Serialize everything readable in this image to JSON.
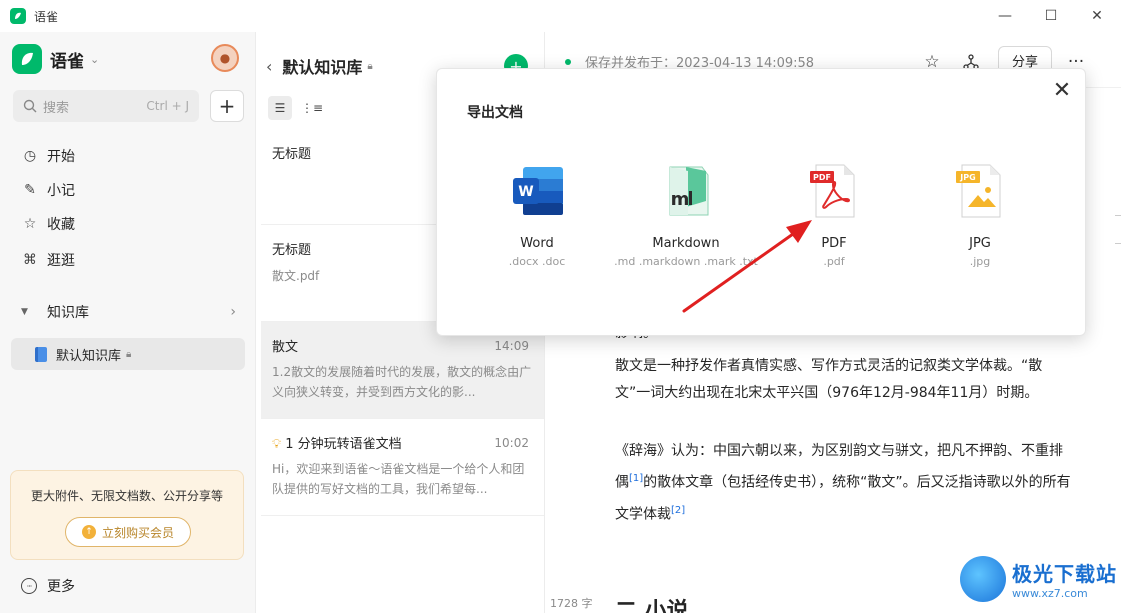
{
  "window": {
    "title": "语雀",
    "minimize": "—",
    "maximize": "☐",
    "close": "✕"
  },
  "sidebar": {
    "brand": "语雀",
    "search_placeholder": "搜索",
    "search_shortcut": "Ctrl + J",
    "add_label": "+",
    "nav": [
      {
        "label": "开始"
      },
      {
        "label": "小记"
      },
      {
        "label": "收藏"
      },
      {
        "label": "逛逛"
      }
    ],
    "knowledge_base_header": "知识库",
    "knowledge_base_item": "默认知识库",
    "promo_text": "更大附件、无限文档数、公开分享等",
    "promo_button": "立刻购买会员",
    "more": "更多"
  },
  "doclist": {
    "title": "默认知识库",
    "items": [
      {
        "title": "无标题",
        "time": "",
        "summary": ""
      },
      {
        "title": "无标题",
        "time": "",
        "summary": "散文.pdf"
      },
      {
        "title": "散文",
        "time": "14:09",
        "summary": "1.2散文的发展随着时代的发展，散文的概念由广义向狭义转变，并受到西方文化的影..."
      },
      {
        "title": "1 分钟玩转语雀文档",
        "time": "10:02",
        "summary": "Hi，欢迎来到语雀～语雀文档是一个给个人和团队提供的写好文档的工具，我们希望每..."
      }
    ]
  },
  "editor": {
    "status": "保存并发布于：2023-04-13 14:09:58",
    "share": "分享",
    "more": "···",
    "partial_text": "影响。",
    "para1": "散文是一种抒发作者真情实感、写作方式灵活的记叙类文学体裁。“散文”一词大约出现在北宋太平兴国（976年12月-984年11月）时期。",
    "para2_a": "《辞海》认为：中国六朝以来，为区别韵文与骈文，把凡不押韵、不重排偶",
    "para2_ref1": "[1]",
    "para2_b": "的散体文章（包括经传史书），统称“散文”。后又泛指诗歌以外的所有文学体裁",
    "para2_ref2": "[2]",
    "word_count": "1728 字",
    "heading_partial": "二 小说"
  },
  "modal": {
    "title": "导出文档",
    "close": "✕",
    "formats": [
      {
        "name": "Word",
        "ext": ".docx .doc",
        "icon": "word-icon"
      },
      {
        "name": "Markdown",
        "ext": ".md .markdown .mark .txt",
        "icon": "markdown-icon"
      },
      {
        "name": "PDF",
        "ext": ".pdf",
        "icon": "pdf-icon"
      },
      {
        "name": "JPG",
        "ext": ".jpg",
        "icon": "jpg-icon"
      }
    ]
  },
  "watermark": {
    "name": "极光下载站",
    "url": "www.xz7.com"
  },
  "colors": {
    "brand_green": "#00b96b",
    "word_blue": "#185abd",
    "pdf_red": "#e02b2b",
    "jpg_yellow": "#f5b52a",
    "arrow_red": "#e02020"
  }
}
